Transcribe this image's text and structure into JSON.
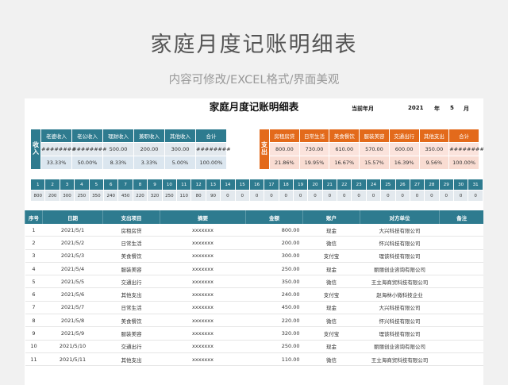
{
  "hero": {
    "title": "家庭月度记账明细表",
    "subtitle": "内容可修改/EXCEL格式/界面美观"
  },
  "sheet": {
    "title": "家庭月度记账明细表",
    "period_label": "当前年月",
    "year": "2021",
    "year_unit": "年",
    "month": "5",
    "month_unit": "月"
  },
  "income": {
    "side_label": "收入",
    "headers": [
      "老婆收入",
      "老公收入",
      "理财收入",
      "兼职收入",
      "其他收入",
      "合计"
    ],
    "amounts": [
      "########",
      "########",
      "500.00",
      "200.00",
      "300.00",
      "########"
    ],
    "percents": [
      "33.33%",
      "50.00%",
      "8.33%",
      "3.33%",
      "5.00%",
      "100.00%"
    ]
  },
  "expense": {
    "side_label": "支出",
    "headers": [
      "房租房贷",
      "日常生活",
      "美食餐饮",
      "服装美容",
      "交通出行",
      "其他支出",
      "合计"
    ],
    "amounts": [
      "800.00",
      "730.00",
      "610.00",
      "570.00",
      "600.00",
      "350.00",
      "########"
    ],
    "percents": [
      "21.86%",
      "19.95%",
      "16.67%",
      "15.57%",
      "16.39%",
      "9.56%",
      "100.00%"
    ]
  },
  "daily": {
    "days": [
      "1",
      "2",
      "3",
      "4",
      "5",
      "6",
      "7",
      "8",
      "9",
      "10",
      "11",
      "12",
      "13",
      "14",
      "15",
      "16",
      "17",
      "18",
      "19",
      "20",
      "21",
      "22",
      "23",
      "24",
      "25",
      "26",
      "27",
      "28",
      "29",
      "30",
      "31"
    ],
    "values": [
      "800",
      "200",
      "300",
      "250",
      "350",
      "240",
      "450",
      "220",
      "320",
      "250",
      "110",
      "80",
      "90",
      "0",
      "0",
      "0",
      "0",
      "0",
      "0",
      "0",
      "0",
      "0",
      "0",
      "0",
      "0",
      "0",
      "0",
      "0",
      "0",
      "0",
      "0"
    ]
  },
  "ledger": {
    "headers": [
      "序号",
      "日期",
      "支出项目",
      "摘要",
      "金额",
      "账户",
      "对方单位",
      "备注"
    ],
    "rows": [
      [
        "1",
        "2021/5/1",
        "房租房贷",
        "xxxxxxx",
        "800.00",
        "现金",
        "大兴科技有限公司",
        ""
      ],
      [
        "2",
        "2021/5/2",
        "日常生活",
        "xxxxxxx",
        "200.00",
        "微信",
        "怀兴科技有限公司",
        ""
      ],
      [
        "3",
        "2021/5/3",
        "美食餐饮",
        "xxxxxxx",
        "300.00",
        "支付宝",
        "理该科技有限公司",
        ""
      ],
      [
        "4",
        "2021/5/4",
        "服装美容",
        "xxxxxxx",
        "250.00",
        "现金",
        "丽丽创业咨询有限公司",
        ""
      ],
      [
        "5",
        "2021/5/5",
        "交通出行",
        "xxxxxxx",
        "350.00",
        "微信",
        "王立海商贸科技有限公司",
        ""
      ],
      [
        "6",
        "2021/5/6",
        "其他支出",
        "xxxxxxx",
        "240.00",
        "支付宝",
        "赵海林小微科技企业",
        ""
      ],
      [
        "7",
        "2021/5/7",
        "日常生活",
        "xxxxxxx",
        "450.00",
        "现金",
        "大兴科技有限公司",
        ""
      ],
      [
        "8",
        "2021/5/8",
        "美食餐饮",
        "xxxxxxx",
        "220.00",
        "微信",
        "怀兴科技有限公司",
        ""
      ],
      [
        "9",
        "2021/5/9",
        "服装美容",
        "xxxxxxx",
        "320.00",
        "支付宝",
        "理该科技有限公司",
        ""
      ],
      [
        "10",
        "2021/5/10",
        "交通出行",
        "xxxxxxx",
        "250.00",
        "现金",
        "丽丽创业咨询有限公司",
        ""
      ],
      [
        "11",
        "2021/5/11",
        "其他支出",
        "xxxxxxx",
        "110.00",
        "微信",
        "王立海商贸科技有限公司",
        ""
      ]
    ]
  }
}
